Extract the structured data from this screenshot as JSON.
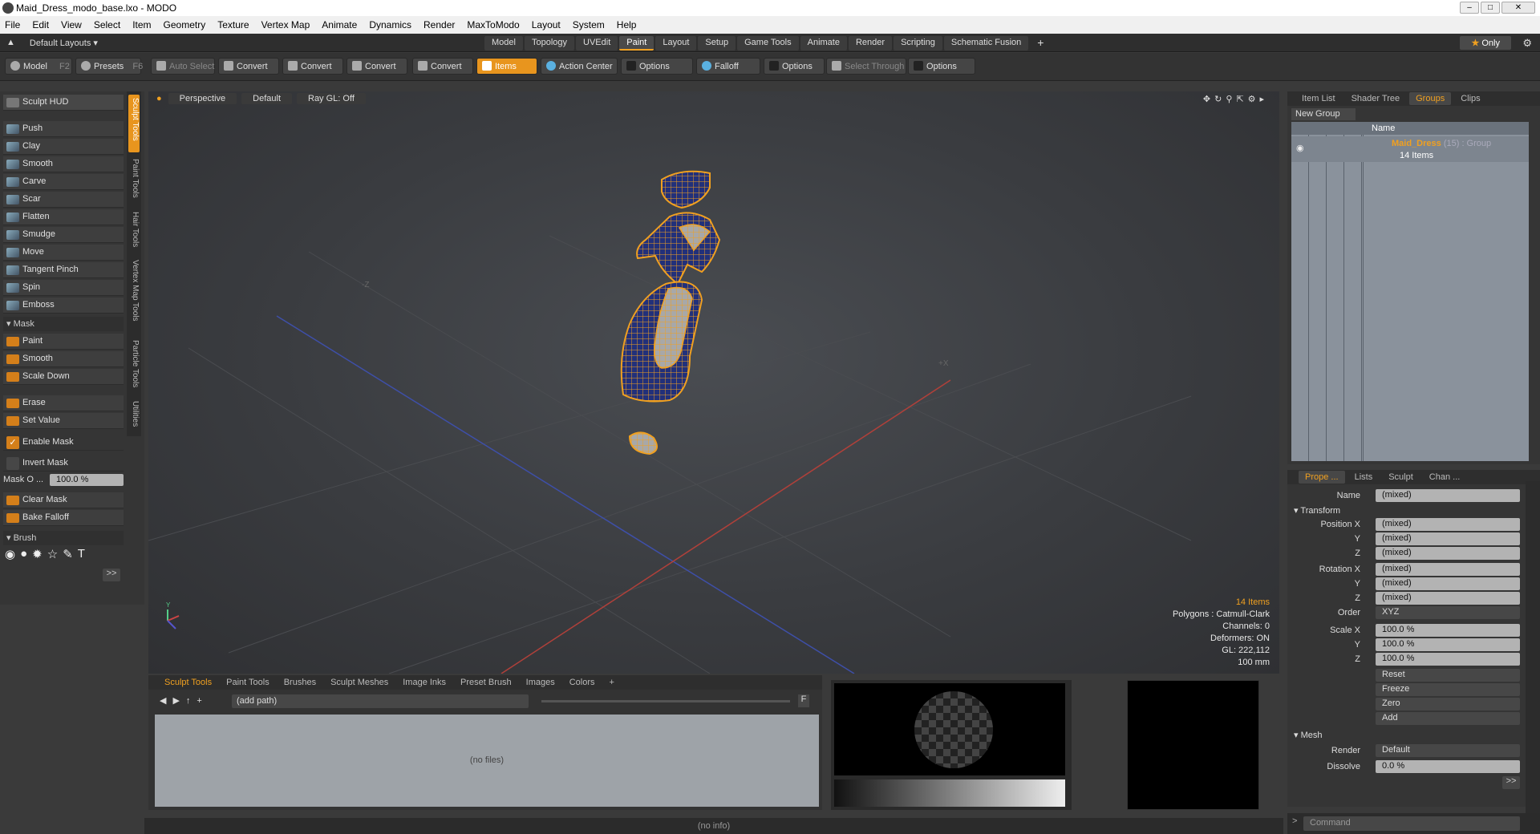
{
  "window": {
    "title": "Maid_Dress_modo_base.lxo - MODO"
  },
  "menu": [
    "File",
    "Edit",
    "View",
    "Select",
    "Item",
    "Geometry",
    "Texture",
    "Vertex Map",
    "Animate",
    "Dynamics",
    "Render",
    "MaxToModo",
    "Layout",
    "System",
    "Help"
  ],
  "layoutbar": {
    "layouts_label": "Default Layouts ▾",
    "tabs": [
      "Model",
      "Topology",
      "UVEdit",
      "Paint",
      "Layout",
      "Setup",
      "Game Tools",
      "Animate",
      "Render",
      "Scripting",
      "Schematic Fusion"
    ],
    "active_tab": "Paint",
    "only_label": "Only"
  },
  "toolbar": {
    "model": "Model",
    "model_key": "F2",
    "presets": "Presets",
    "presets_key": "F6",
    "auto_select": "Auto Select",
    "convert1": "Convert",
    "convert2": "Convert",
    "convert3": "Convert",
    "convert4": "Convert",
    "items": "Items",
    "action_center": "Action Center",
    "options1": "Options",
    "falloff": "Falloff",
    "options2": "Options",
    "select_through": "Select Through",
    "options3": "Options"
  },
  "left": {
    "sculpt_hud": "Sculpt HUD",
    "tools": [
      "Push",
      "Clay",
      "Smooth",
      "Carve",
      "Scar",
      "Flatten",
      "Smudge",
      "Move",
      "Tangent Pinch",
      "Spin",
      "Emboss"
    ],
    "mask_header": "Mask",
    "mask_tools": [
      "Paint",
      "Smooth",
      "Scale Down"
    ],
    "erase": "Erase",
    "set_value": "Set Value",
    "enable_mask": "Enable Mask",
    "invert_mask": "Invert Mask",
    "mask_opacity_label": "Mask O ...",
    "mask_opacity_value": "100.0 %",
    "clear_mask": "Clear Mask",
    "bake_falloff": "Bake Falloff",
    "brush_header": "Brush",
    "more": ">>"
  },
  "vtabs": [
    "Sculpt Tools",
    "Paint Tools",
    "Hair Tools",
    "Vertex Map Tools",
    "Particle Tools",
    "Utilities"
  ],
  "viewport": {
    "view": "Perspective",
    "shading": "Default",
    "raygl": "Ray GL: Off",
    "stats": {
      "items": "14 Items",
      "polygons": "Polygons : Catmull-Clark",
      "channels": "Channels: 0",
      "deformers": "Deformers: ON",
      "gl": "GL: 222,112",
      "scale": "100 mm"
    }
  },
  "right": {
    "tabs": [
      "Item List",
      "Shader Tree",
      "Groups",
      "Clips"
    ],
    "active_tab": "Groups",
    "new_group": "New Group",
    "name_header": "Name",
    "group_name": "Maid_Dress",
    "group_meta": "(15) : Group",
    "group_items": "14 Items"
  },
  "props": {
    "tabs": [
      "Prope ...",
      "Lists",
      "Sculpt",
      "Chan ..."
    ],
    "name_label": "Name",
    "name_value": "(mixed)",
    "transform": "Transform",
    "position_x": "Position X",
    "y": "Y",
    "z": "Z",
    "rotation_x": "Rotation X",
    "mixed": "(mixed)",
    "order_label": "Order",
    "order_value": "XYZ",
    "scale_x": "Scale X",
    "scale_value": "100.0 %",
    "reset": "Reset",
    "freeze": "Freeze",
    "zero": "Zero",
    "add": "Add",
    "mesh": "Mesh",
    "render_label": "Render",
    "render_value": "Default",
    "dissolve_label": "Dissolve",
    "dissolve_value": "0.0 %",
    "more": ">>"
  },
  "bottom": {
    "tabs": [
      "Sculpt Tools",
      "Paint Tools",
      "Brushes",
      "Sculpt Meshes",
      "Image Inks",
      "Preset Brush",
      "Images",
      "Colors"
    ],
    "path_placeholder": "(add path)",
    "no_files": "(no files)",
    "f_label": "F"
  },
  "status": {
    "info": "(no info)",
    "command_placeholder": "Command"
  },
  "colors": {
    "accent": "#e8951e",
    "wire": "#f0a020",
    "mesh_fill": "#2a3a8a"
  }
}
